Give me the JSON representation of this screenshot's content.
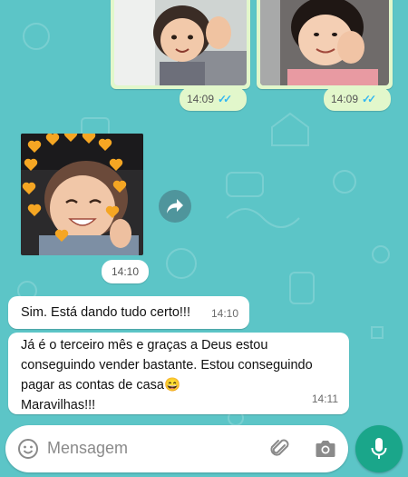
{
  "colors": {
    "wallpaper": "#5cc5c7",
    "outgoing_bubble": "#e2f7cb",
    "incoming_bubble": "#ffffff",
    "read_ticks": "#34b7f1",
    "mic_button": "#1aa68a"
  },
  "chat": {
    "top_images": [
      {
        "time": "14:09",
        "status": "read"
      },
      {
        "time": "14:09",
        "status": "read"
      }
    ],
    "hearts_image": {
      "time": "14:10"
    },
    "messages": [
      {
        "lines": [
          "Sim. Está dando tudo certo!!!"
        ],
        "time": "14:10"
      },
      {
        "lines": [
          "Já é o terceiro mês e graças a Deus estou",
          "conseguindo vender bastante. Estou conseguindo",
          "pagar as contas de casa😄",
          "Maravilhas!!!"
        ],
        "time": "14:11"
      }
    ]
  },
  "composer": {
    "placeholder": "Mensagem",
    "icons": [
      "emoji-icon",
      "attach-icon",
      "camera-icon",
      "mic-icon"
    ]
  }
}
